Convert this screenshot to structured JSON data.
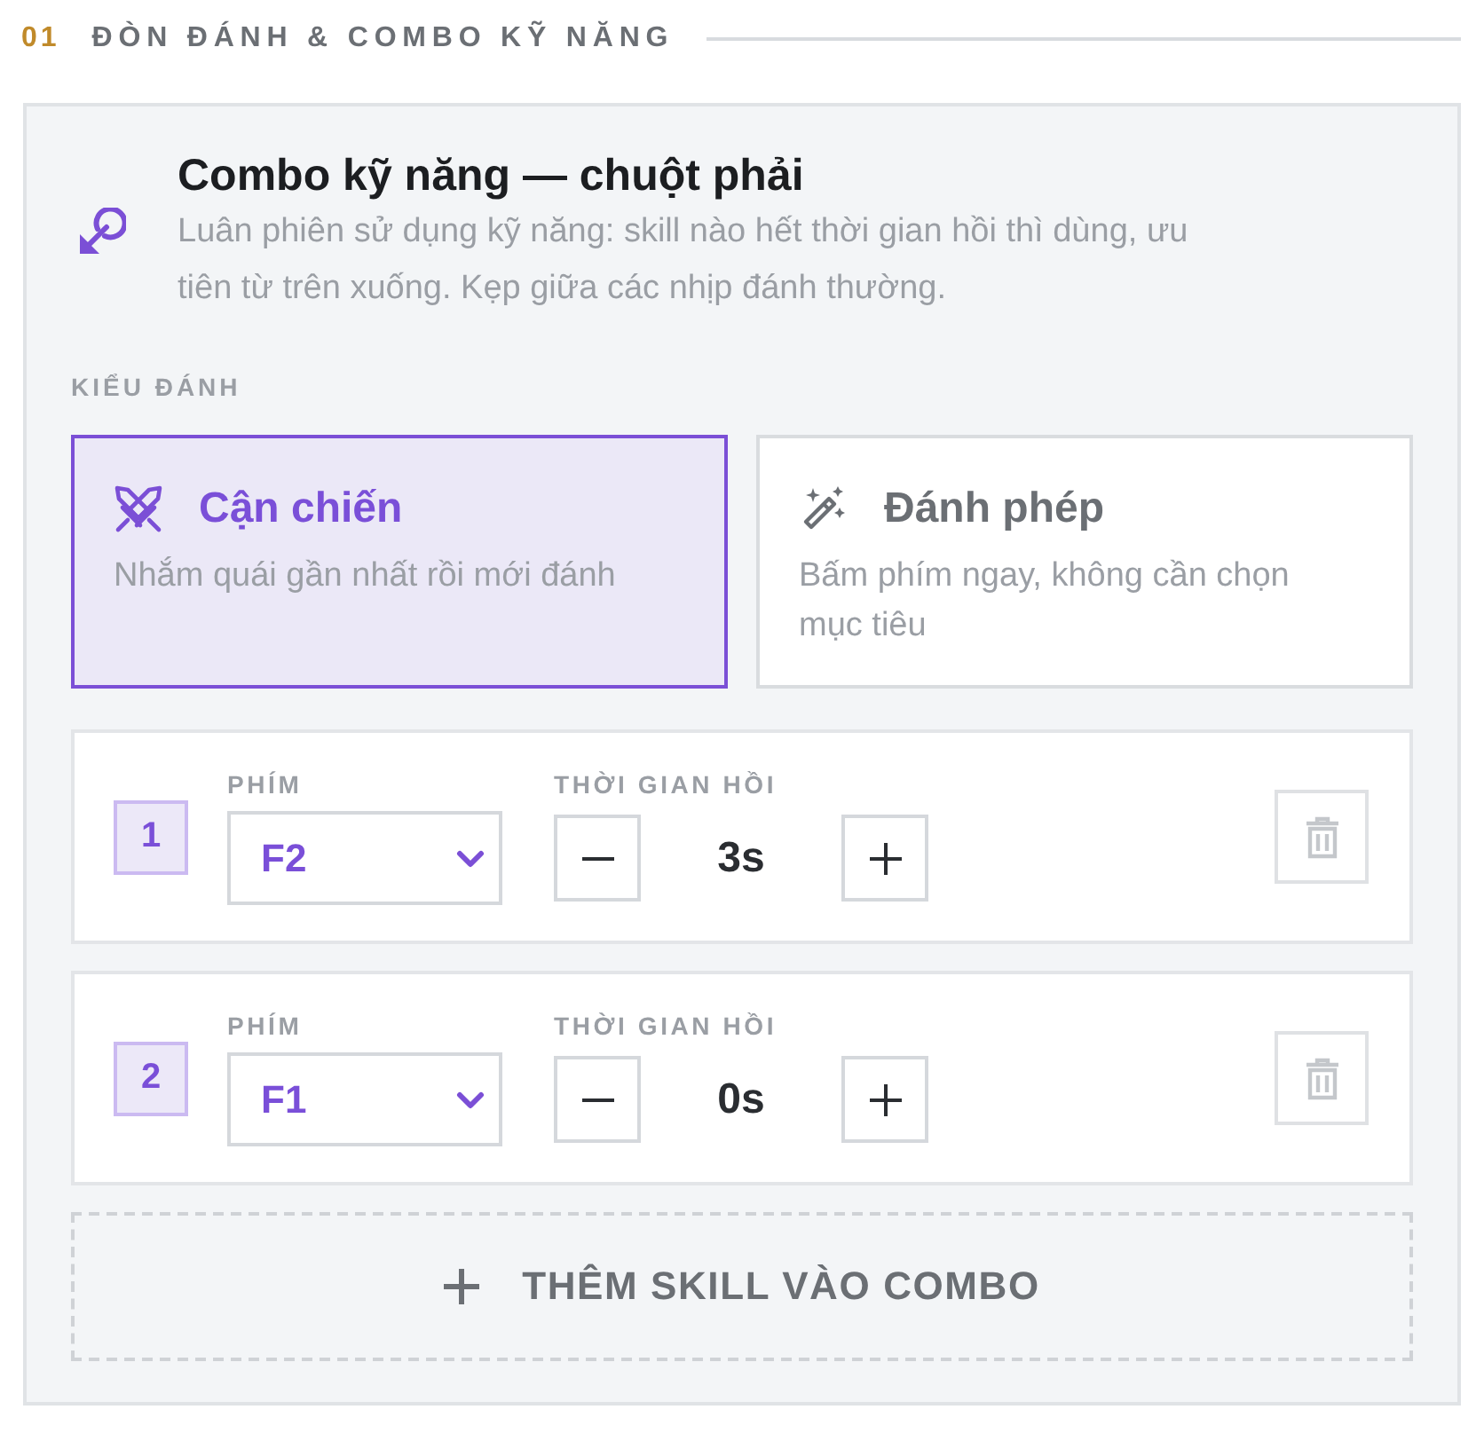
{
  "section": {
    "number": "01",
    "title": "ĐÒN ĐÁNH & COMBO KỸ NĂNG"
  },
  "panel": {
    "title": "Combo kỹ năng — chuột phải",
    "description": "Luân phiên sử dụng kỹ năng: skill nào hết thời gian hồi thì dùng, ưu tiên từ trên xuống. Kẹp giữa các nhịp đánh thường.",
    "mode_label": "KIỂU ĐÁNH",
    "modes": [
      {
        "kind": "melee",
        "label": "Cận chiến",
        "description": "Nhắm quái gần nhất rồi mới đánh",
        "selected": true
      },
      {
        "kind": "magic",
        "label": "Đánh phép",
        "description": "Bấm phím ngay, không cần chọn mục tiêu",
        "selected": false
      }
    ],
    "skills": [
      {
        "index": "1",
        "key_label": "PHÍM",
        "key": "F2",
        "cooldown_label": "THỜI GIAN HỒI",
        "cooldown": "3s"
      },
      {
        "index": "2",
        "key_label": "PHÍM",
        "key": "F1",
        "cooldown_label": "THỜI GIAN HỒI",
        "cooldown": "0s"
      }
    ],
    "add_button": "THÊM SKILL VÀO COMBO"
  }
}
